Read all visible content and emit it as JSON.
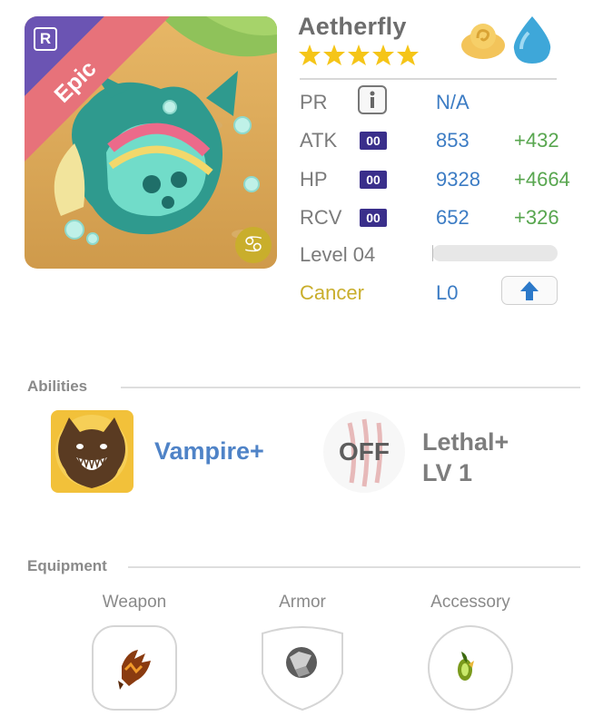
{
  "character": {
    "name": "Aetherfly",
    "rarity_label": "Epic",
    "rarity_badge": "R",
    "star_count": 5,
    "elements": [
      "cloud-element-icon",
      "water-element-icon"
    ],
    "zodiac_symbol": "♋"
  },
  "stats": {
    "pr": {
      "label": "PR",
      "value": "N/A"
    },
    "atk": {
      "label": "ATK",
      "badge": "00",
      "base": "853",
      "bonus": "+432"
    },
    "hp": {
      "label": "HP",
      "badge": "00",
      "base": "9328",
      "bonus": "+4664"
    },
    "rcv": {
      "label": "RCV",
      "badge": "00",
      "base": "652",
      "bonus": "+326"
    },
    "level": {
      "label": "Level 04",
      "progress": 0.01
    },
    "sign": {
      "label": "Cancer",
      "value": "L0"
    }
  },
  "abilities": {
    "title": "Abilities",
    "primary": {
      "name": "Vampire+",
      "icon": "wolf-icon"
    },
    "secondary": {
      "state": "OFF",
      "name_line1": "Lethal+",
      "name_line2": "LV 1",
      "icon": "claw-slash-icon"
    }
  },
  "equipment": {
    "title": "Equipment",
    "slots": [
      {
        "label": "Weapon",
        "icon": "claw-weapon-icon"
      },
      {
        "label": "Armor",
        "icon": "steel-orb-icon"
      },
      {
        "label": "Accessory",
        "icon": "green-gem-icon"
      }
    ]
  },
  "colors": {
    "stat_base": "#3c7cc4",
    "stat_bonus": "#58a64f",
    "badge_bg": "#3a2f8b",
    "cancer_gold": "#c9ae2c",
    "epic_ribbon": "#e7727a"
  }
}
